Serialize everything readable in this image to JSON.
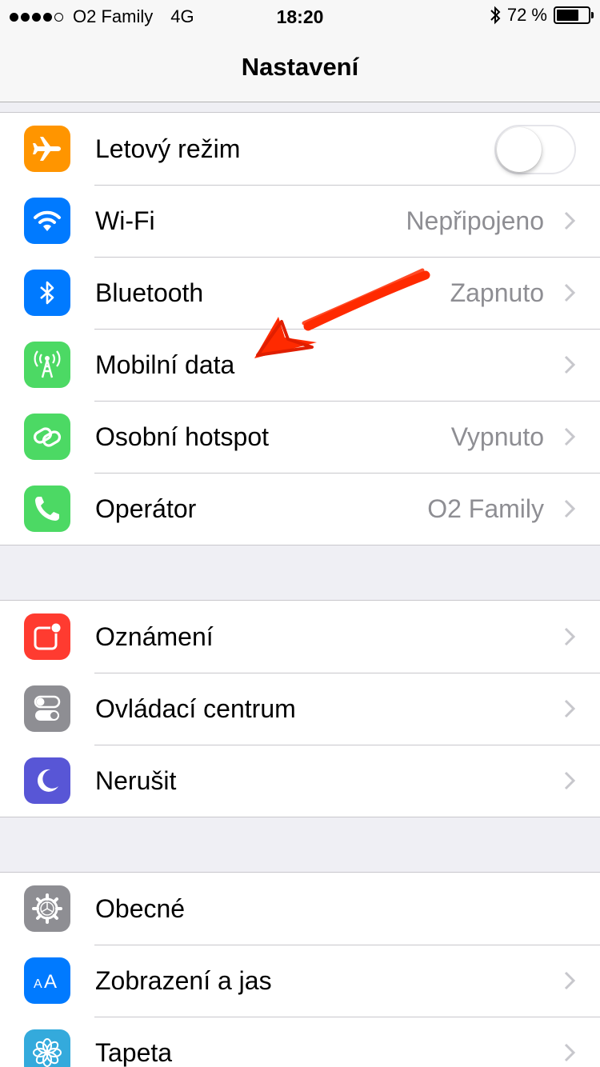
{
  "status_bar": {
    "carrier": "O2 Family",
    "network": "4G",
    "time": "18:20",
    "battery": "72 %",
    "battery_level": 0.72,
    "signal_bars": 4,
    "signal_max": 5
  },
  "nav": {
    "title": "Nastavení"
  },
  "groups": [
    {
      "items": [
        {
          "label": "Letový režim",
          "icon": "airplane-icon",
          "color": "#ff9500",
          "toggle": false
        },
        {
          "label": "Wi-Fi",
          "value": "Nepřipojeno",
          "icon": "wifi-icon",
          "color": "#007aff"
        },
        {
          "label": "Bluetooth",
          "value": "Zapnuto",
          "icon": "bluetooth-icon",
          "color": "#007aff"
        },
        {
          "label": "Mobilní data",
          "value": "",
          "icon": "cellular-antenna-icon",
          "color": "#4cd964"
        },
        {
          "label": "Osobní hotspot",
          "value": "Vypnuto",
          "icon": "hotspot-icon",
          "color": "#4cd964"
        },
        {
          "label": "Operátor",
          "value": "O2 Family",
          "icon": "phone-icon",
          "color": "#4cd964"
        }
      ]
    },
    {
      "items": [
        {
          "label": "Oznámení",
          "icon": "notifications-icon",
          "color": "#ff3b30"
        },
        {
          "label": "Ovládací centrum",
          "icon": "control-center-icon",
          "color": "#8e8e93"
        },
        {
          "label": "Nerušit",
          "icon": "moon-icon",
          "color": "#5856d6"
        }
      ]
    },
    {
      "items": [
        {
          "label": "Obecné",
          "icon": "gear-icon",
          "color": "#8e8e93"
        },
        {
          "label": "Zobrazení a jas",
          "icon": "text-size-icon",
          "color": "#007aff"
        },
        {
          "label": "Tapeta",
          "icon": "wallpaper-flower-icon",
          "color": "#34aadc"
        }
      ]
    }
  ],
  "colors": {
    "annotation_arrow": "#ff2a00",
    "chevron": "#c7c7cc",
    "secondary_text": "#8e8e93"
  }
}
